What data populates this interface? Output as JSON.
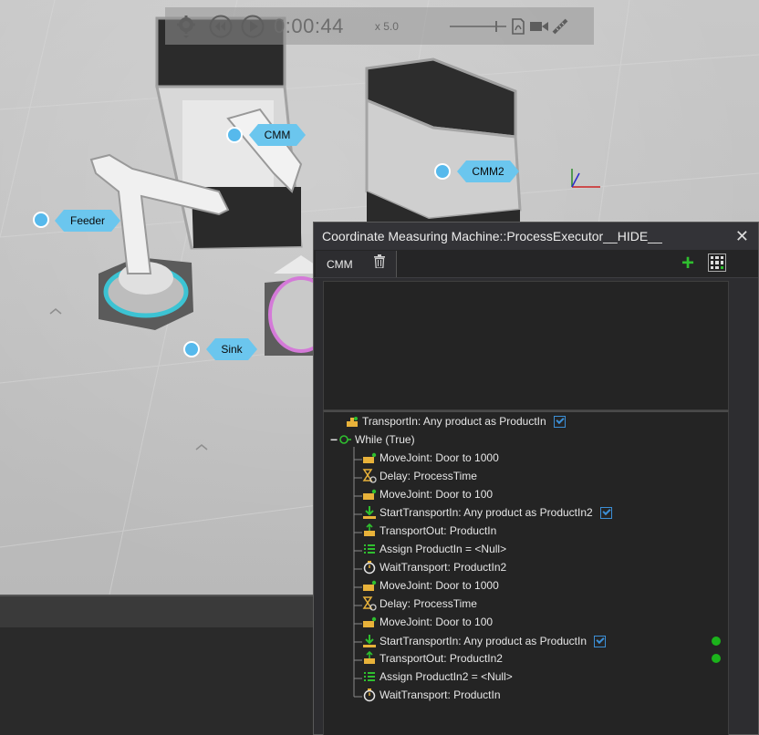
{
  "playback": {
    "time": "0:00:44",
    "speed": "x 5.0",
    "icons": [
      "gear-icon",
      "rewind-icon",
      "play-icon",
      "pdf-icon",
      "video-camera-icon",
      "measure-icon"
    ]
  },
  "scene_labels": {
    "cmm": "CMM",
    "cmm2": "CMM2",
    "feeder": "Feeder",
    "sink": "Sink"
  },
  "panel": {
    "title": "Coordinate Measuring Machine::ProcessExecutor__HIDE__",
    "tab_label": "CMM",
    "statements": [
      {
        "text": "TransportIn: Any product as ProductIn",
        "icon": "transport-in-icon",
        "checkbox": true
      },
      {
        "text": "While (True)",
        "icon": "loop-icon"
      },
      {
        "text": "MoveJoint: Door to 1000",
        "icon": "move-joint-icon"
      },
      {
        "text": "Delay: ProcessTime",
        "icon": "hourglass-icon"
      },
      {
        "text": "MoveJoint: Door to 100",
        "icon": "move-joint-icon"
      },
      {
        "text": "StartTransportIn: Any product as ProductIn2",
        "icon": "start-transport-icon",
        "checkbox": true
      },
      {
        "text": "TransportOut: ProductIn",
        "icon": "transport-out-icon"
      },
      {
        "text": "Assign ProductIn = <Null>",
        "icon": "assign-icon"
      },
      {
        "text": "WaitTransport: ProductIn2",
        "icon": "stopwatch-icon"
      },
      {
        "text": "MoveJoint: Door to 1000",
        "icon": "move-joint-icon"
      },
      {
        "text": "Delay: ProcessTime",
        "icon": "hourglass-icon"
      },
      {
        "text": "MoveJoint: Door to 100",
        "icon": "move-joint-icon"
      },
      {
        "text": "StartTransportIn: Any product as ProductIn",
        "icon": "start-transport-icon",
        "checkbox": true,
        "active": true
      },
      {
        "text": "TransportOut: ProductIn2",
        "icon": "transport-out-icon",
        "active": true
      },
      {
        "text": "Assign ProductIn2 = <Null>",
        "icon": "assign-icon"
      },
      {
        "text": "WaitTransport: ProductIn",
        "icon": "stopwatch-icon"
      }
    ]
  },
  "colors": {
    "accent_blue": "#6bc6ee",
    "active_dot": "#1bb31b",
    "add_green": "#2fbf2f"
  }
}
